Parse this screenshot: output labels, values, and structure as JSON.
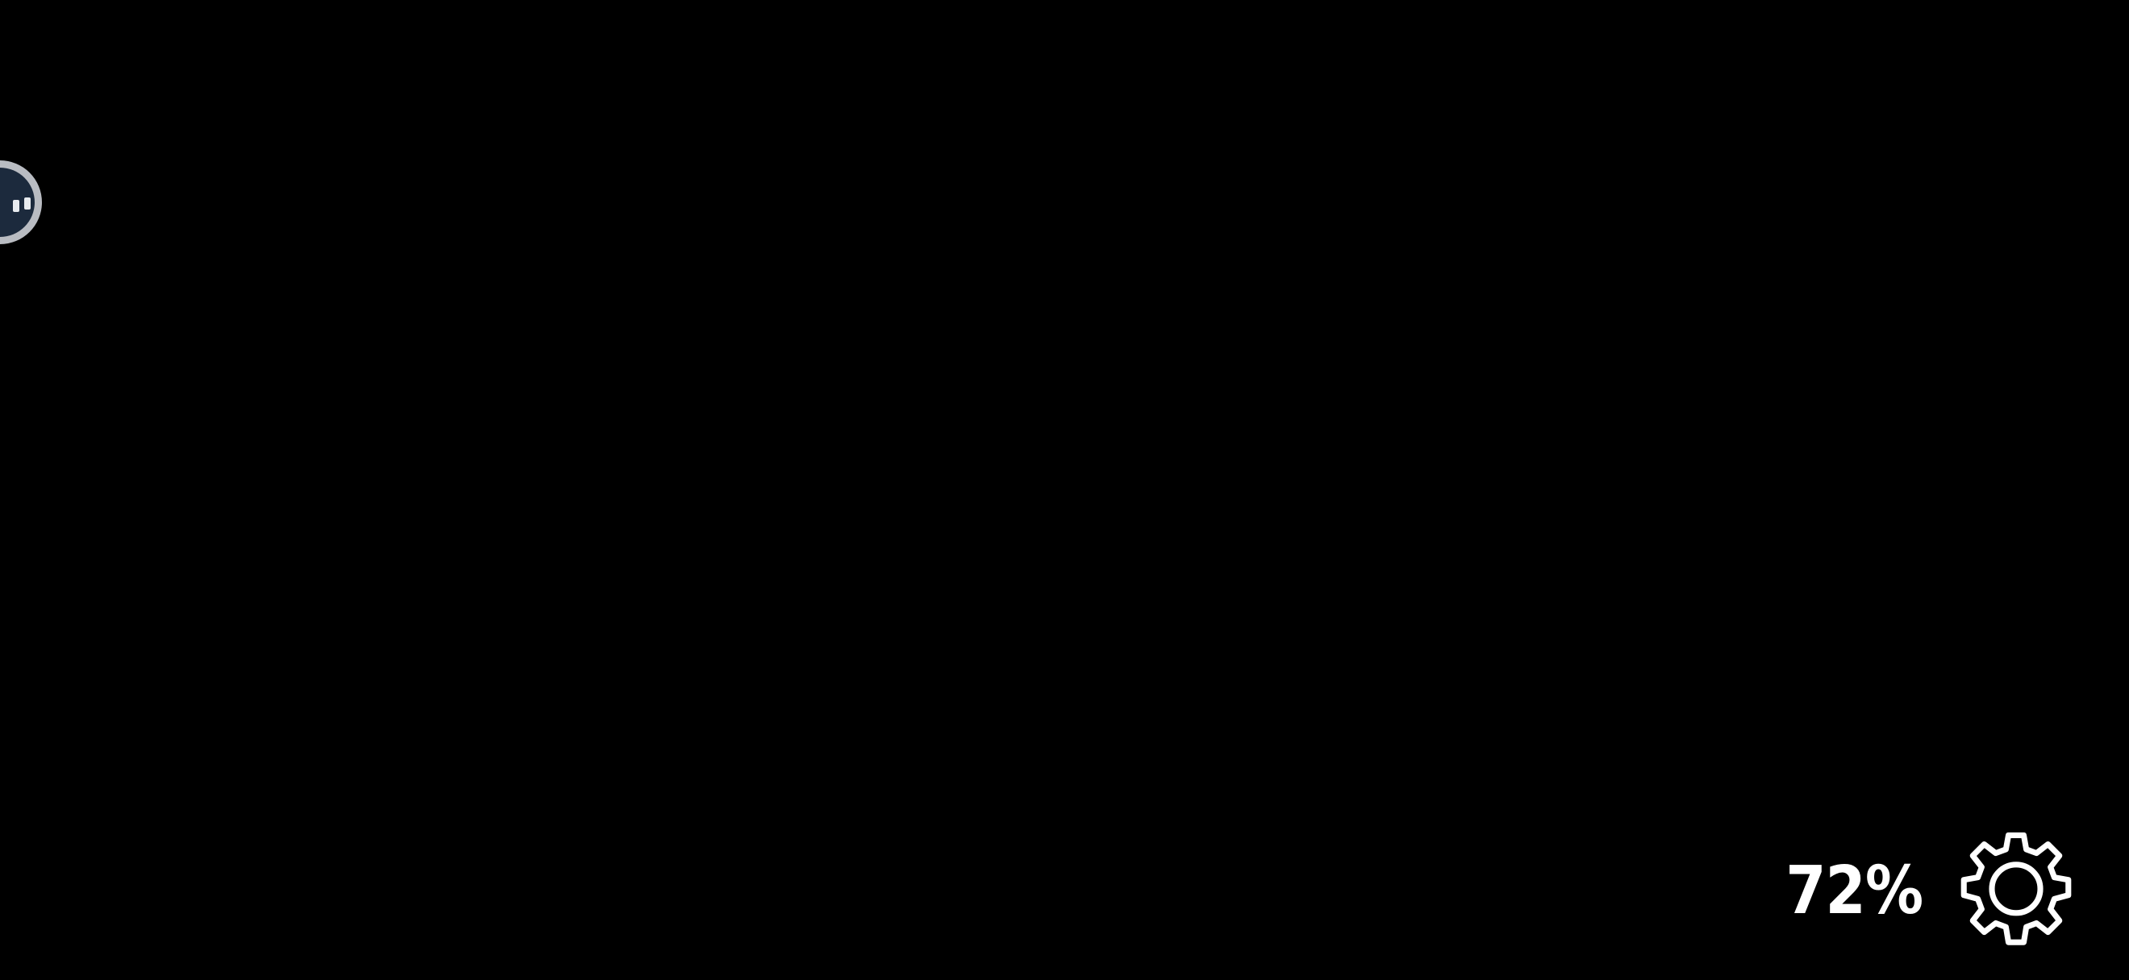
{
  "overlay": {
    "percent_text": "72%",
    "icons": {
      "settings": "gear-icon",
      "floating_assistant": "assistant-bubble-icon"
    }
  },
  "colors": {
    "background": "#000000",
    "text": "#ffffff",
    "bubble_ring": "#b9bcc2",
    "bubble_fill": "#1c2a3d"
  }
}
